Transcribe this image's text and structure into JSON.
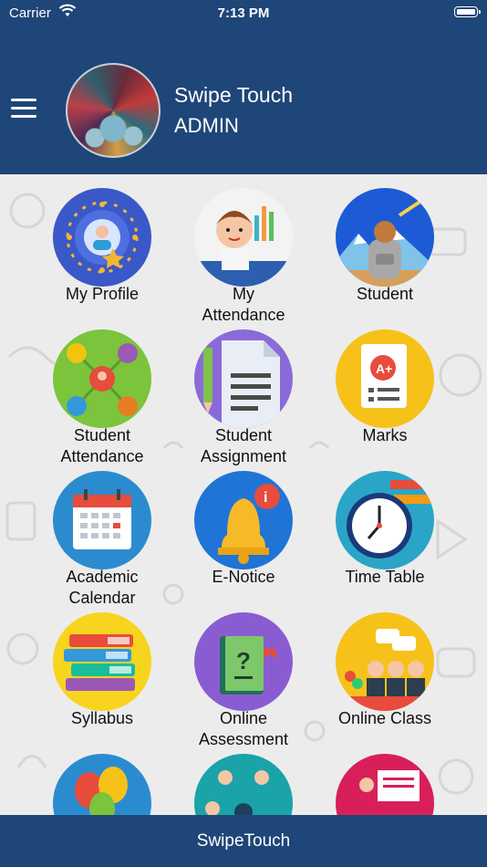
{
  "status_bar": {
    "carrier": "Carrier",
    "time": "7:13 PM"
  },
  "header": {
    "user_name": "Swipe Touch",
    "user_role": "ADMIN"
  },
  "tiles": [
    {
      "label": "My Profile"
    },
    {
      "label": "My\nAttendance"
    },
    {
      "label": "Student"
    },
    {
      "label": "Student\nAttendance"
    },
    {
      "label": "Student\nAssignment"
    },
    {
      "label": "Marks"
    },
    {
      "label": "Academic\nCalendar"
    },
    {
      "label": "E-Notice"
    },
    {
      "label": "Time Table"
    },
    {
      "label": "Syllabus"
    },
    {
      "label": "Online\nAssessment"
    },
    {
      "label": "Online Class"
    },
    {
      "label": ""
    },
    {
      "label": ""
    },
    {
      "label": ""
    }
  ],
  "footer": {
    "title": "SwipeTouch"
  }
}
